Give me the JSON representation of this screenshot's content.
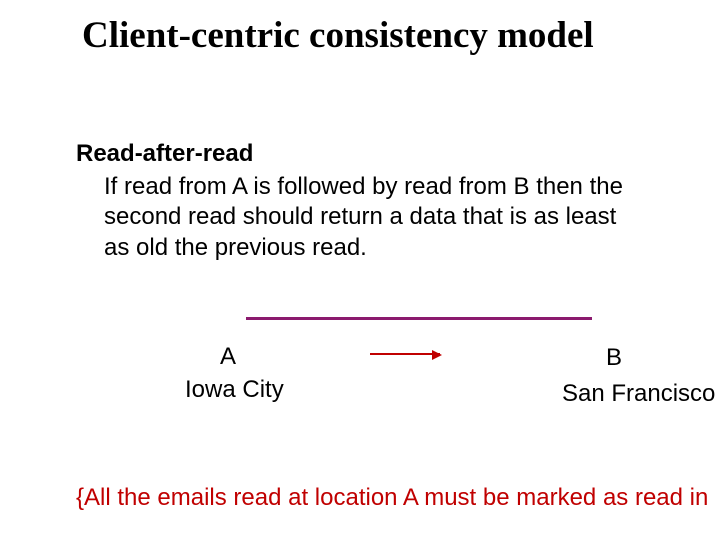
{
  "slide": {
    "title": "Client-centric consistency model",
    "subhead": "Read-after-read",
    "paragraph": "If read from A is followed by read from B then the second read should return a data that is as least as old the previous read.",
    "node_left": {
      "label": "A",
      "city": "Iowa City"
    },
    "node_right": {
      "label": "B",
      "city": "San Francisco"
    },
    "footnote": "{All the emails read at location A must be marked as read in"
  }
}
